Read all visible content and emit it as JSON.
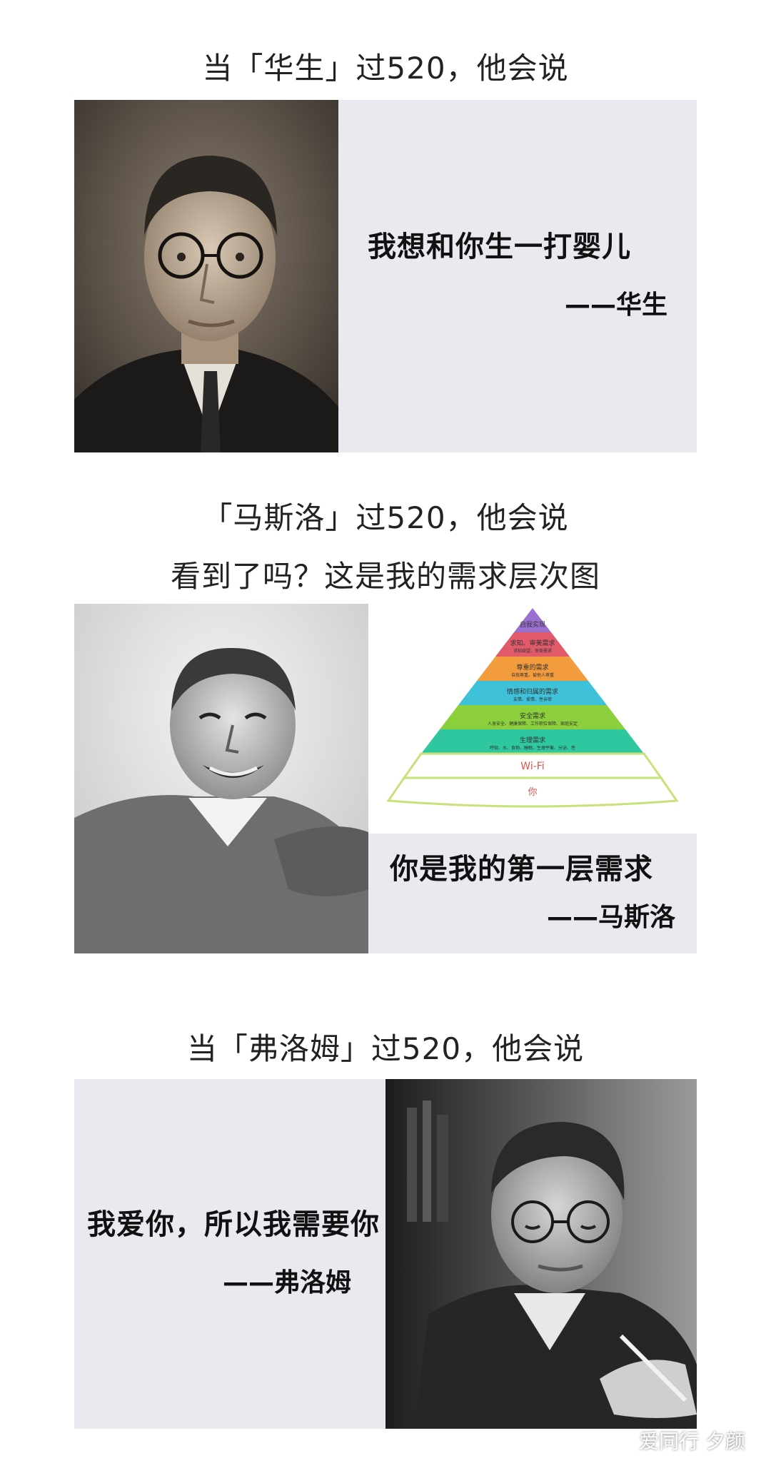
{
  "section1": {
    "caption": "当「华生」过520，他会说",
    "quote": "我想和你生一打婴儿",
    "author": "——华生"
  },
  "section2": {
    "caption_line1": "「马斯洛」过520，他会说",
    "caption_line2": "看到了吗？这是我的需求层次图",
    "quote": "你是我的第一层需求",
    "author": "——马斯洛",
    "pyramid": {
      "levels": [
        {
          "label": "自我实现",
          "sub": "",
          "color": "#9b6fd0"
        },
        {
          "label": "求知、审美需求",
          "sub": "求知欲望、审美需求",
          "color": "#e05a6a"
        },
        {
          "label": "尊重的需求",
          "sub": "自我尊重、被他人尊重",
          "color": "#f39c3d"
        },
        {
          "label": "情感和归属的需求",
          "sub": "友情、爱情、性亲密",
          "color": "#3fc1d9"
        },
        {
          "label": "安全需求",
          "sub": "人身安全、健康保障、工作职位保障、家庭安定",
          "color": "#8ccf3c"
        },
        {
          "label": "生理需求",
          "sub": "呼吸、水、食物、睡眠、生理平衡、分泌、性",
          "color": "#2ec7a0"
        },
        {
          "label": "Wi-Fi",
          "sub": "",
          "color": "#ffffff"
        },
        {
          "label": "你",
          "sub": "",
          "color": "#ffffff"
        }
      ]
    }
  },
  "section3": {
    "caption": "当「弗洛姆」过520，他会说",
    "quote": "我爱你，所以我需要你",
    "author": "——弗洛姆"
  },
  "watermark": {
    "text": "爱同行 夕颜",
    "icon": "wechat-icon"
  }
}
